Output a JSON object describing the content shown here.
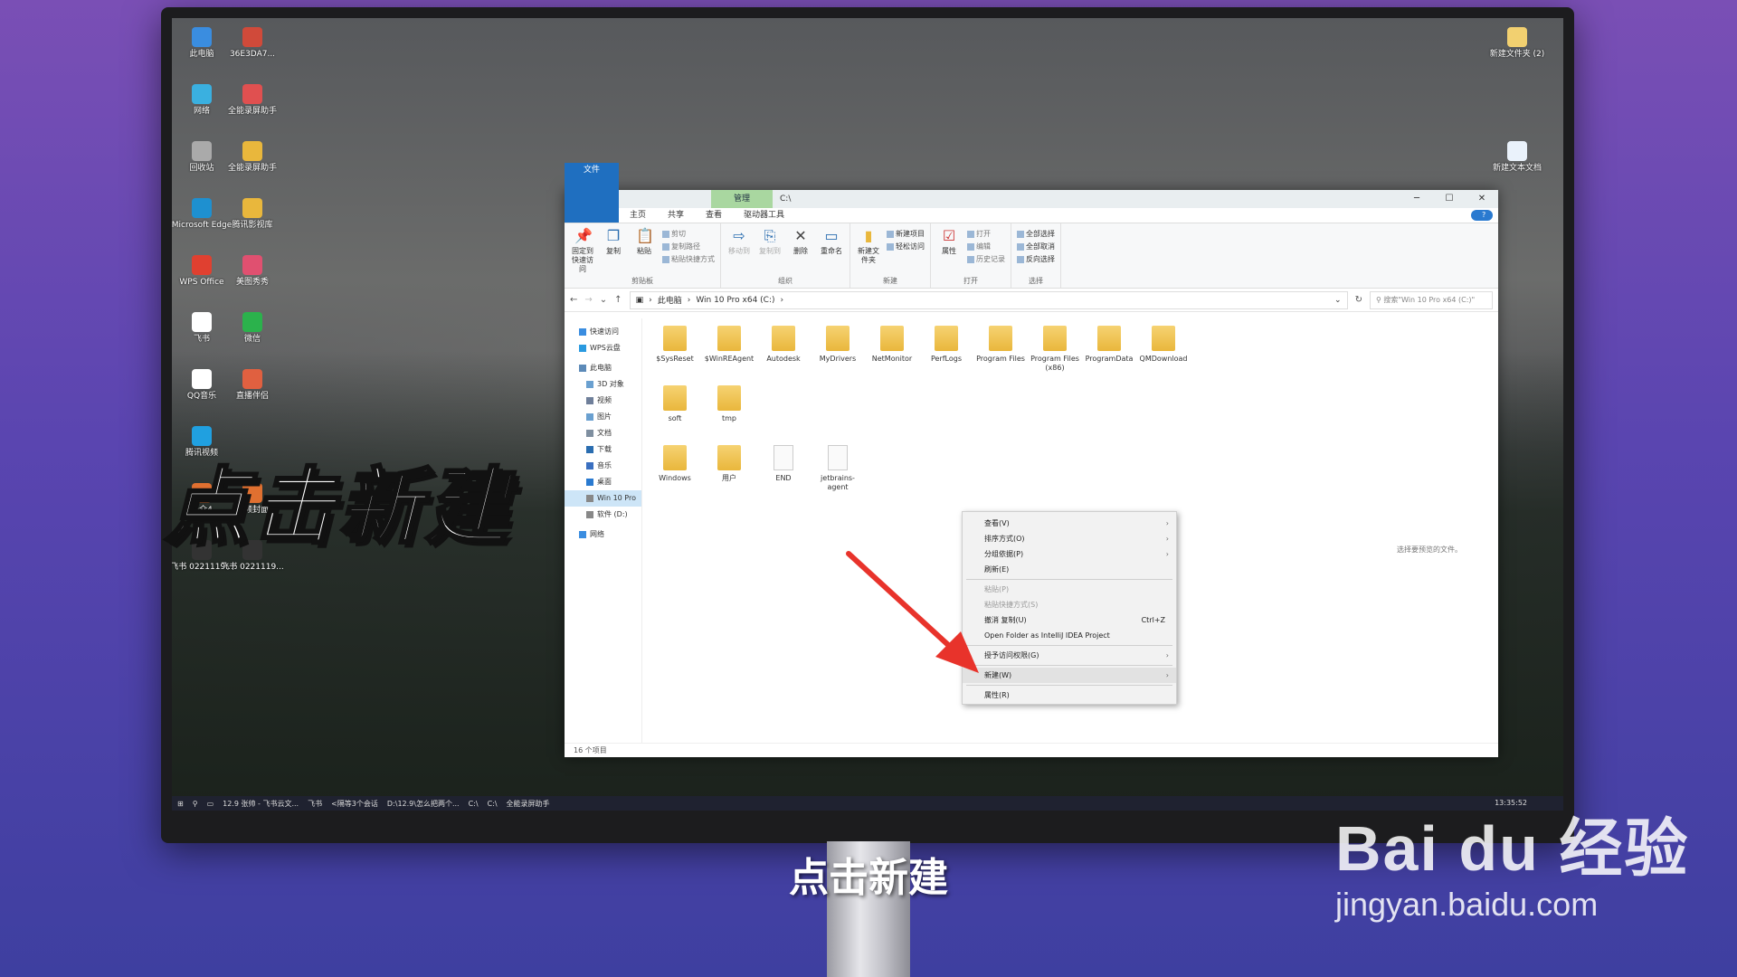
{
  "desktop": {
    "icons_left": [
      "此电脑",
      "36E3DA7...",
      "网络",
      "全能录屏助手",
      "回收站",
      "全能录屏助手",
      "Microsoft Edge",
      "腾讯影视库",
      "WPS Office",
      "美图秀秀",
      "飞书",
      "微信",
      "QQ音乐",
      "直播伴侣",
      "腾讯视频",
      "",
      "简介4",
      "视频封面",
      "飞书 0221119...",
      "飞书 0221119..."
    ],
    "icons_right": [
      "新建文件夹 (2)",
      "新建文本文档"
    ]
  },
  "explorer": {
    "title": "C:\\",
    "manage_tab": "管理",
    "window_controls": [
      "─",
      "☐",
      "✕"
    ],
    "tabs": [
      "文件",
      "主页",
      "共享",
      "查看",
      "驱动器工具"
    ],
    "ribbon": {
      "clipboard": {
        "label": "剪贴板",
        "pin": "固定到快速访问",
        "copy": "复制",
        "paste": "粘贴",
        "cut": "剪切",
        "copy_path": "复制路径",
        "paste_shortcut": "粘贴快捷方式"
      },
      "organize": {
        "label": "组织",
        "move_to": "移动到",
        "copy_to": "复制到",
        "delete": "删除",
        "rename": "重命名"
      },
      "new": {
        "label": "新建",
        "new_folder": "新建文件夹",
        "new_item": "新建项目",
        "easy_access": "轻松访问"
      },
      "open": {
        "label": "打开",
        "properties": "属性",
        "open": "打开",
        "edit": "编辑",
        "history": "历史记录"
      },
      "select": {
        "label": "选择",
        "select_all": "全部选择",
        "select_none": "全部取消",
        "invert": "反向选择"
      }
    },
    "address": [
      "此电脑",
      "Win 10 Pro x64 (C:)"
    ],
    "search_placeholder": "搜索\"Win 10 Pro x64 (C:)\"",
    "nav": [
      "快速访问",
      "WPS云盘",
      "此电脑",
      "3D 对象",
      "视频",
      "图片",
      "文档",
      "下载",
      "音乐",
      "桌面",
      "Win 10 Pro",
      "软件 (D:)",
      "网络"
    ],
    "files": [
      {
        "name": "$SysReset",
        "type": "folder"
      },
      {
        "name": "$WinREAgent",
        "type": "folder"
      },
      {
        "name": "Autodesk",
        "type": "folder"
      },
      {
        "name": "MyDrivers",
        "type": "folder"
      },
      {
        "name": "NetMonitor",
        "type": "folder"
      },
      {
        "name": "PerfLogs",
        "type": "folder"
      },
      {
        "name": "Program Files",
        "type": "folder"
      },
      {
        "name": "Program Files (x86)",
        "type": "folder"
      },
      {
        "name": "ProgramData",
        "type": "folder"
      },
      {
        "name": "QMDownload",
        "type": "folder"
      },
      {
        "name": "soft",
        "type": "folder"
      },
      {
        "name": "tmp",
        "type": "folder"
      },
      {
        "name": "Windows",
        "type": "folder"
      },
      {
        "name": "用户",
        "type": "folder"
      },
      {
        "name": "END",
        "type": "doc"
      },
      {
        "name": "jetbrains-agent",
        "type": "doc"
      }
    ],
    "preview_text": "选择要预览的文件。",
    "status": "16 个项目"
  },
  "context_menu": {
    "items": [
      {
        "label": "查看(V)",
        "arrow": true
      },
      {
        "label": "排序方式(O)",
        "arrow": true
      },
      {
        "label": "分组依据(P)",
        "arrow": true
      },
      {
        "label": "刷新(E)"
      },
      {
        "sep": true
      },
      {
        "label": "粘贴(P)",
        "disabled": true
      },
      {
        "label": "粘贴快捷方式(S)",
        "disabled": true
      },
      {
        "label": "撤消 复制(U)",
        "shortcut": "Ctrl+Z"
      },
      {
        "label": "Open Folder as IntelliJ IDEA Project"
      },
      {
        "sep": true
      },
      {
        "label": "授予访问权限(G)",
        "arrow": true
      },
      {
        "sep": true
      },
      {
        "label": "新建(W)",
        "arrow": true,
        "highlight": true
      },
      {
        "sep": true
      },
      {
        "label": "属性(R)"
      }
    ]
  },
  "taskbar": {
    "items": [
      "12.9 张帅 - 飞书云文...",
      "飞书",
      "<隔等3个会话",
      "D:\\12.9\\怎么把两个...",
      "C:\\",
      "C:\\",
      "全能录屏助手"
    ],
    "clock": "13:35:52"
  },
  "overlay": {
    "big_caption": "点击新建",
    "subtitle": "点击新建",
    "watermark_brand": "Bai du 经验",
    "watermark_url": "jingyan.baidu.com"
  },
  "colors": {
    "file_tab": "#1f6fc0",
    "manage_tab": "#a9d7a0",
    "arrow": "#e8332b"
  }
}
